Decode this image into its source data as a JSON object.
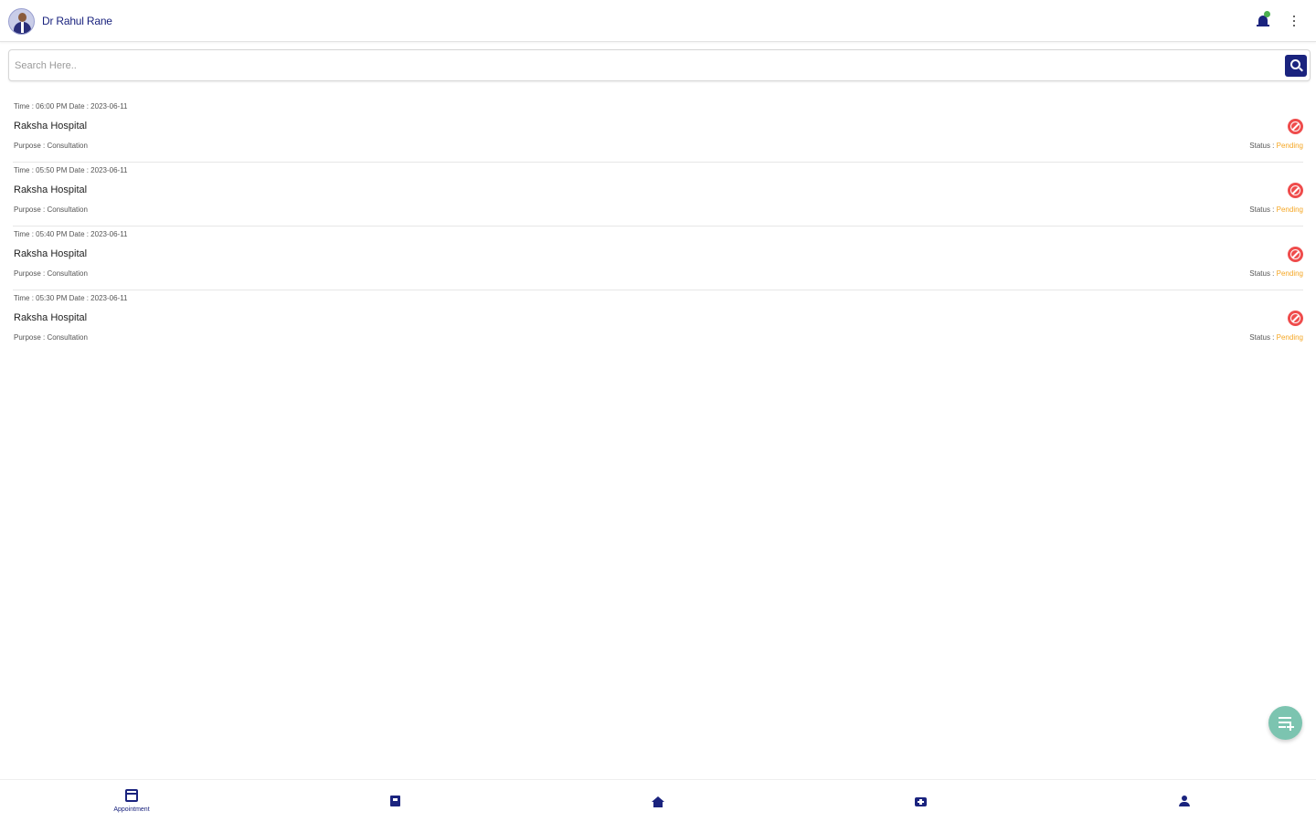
{
  "header": {
    "user_name": "Dr Rahul Rane"
  },
  "search": {
    "placeholder": "Search Here.."
  },
  "appointments": [
    {
      "meta": "Time : 06:00 PM  Date : 2023-06-11",
      "hospital": "Raksha Hospital",
      "purpose": "Purpose : Consultation",
      "status_label": "Status : ",
      "status_value": "Pending"
    },
    {
      "meta": "Time : 05:50 PM  Date : 2023-06-11",
      "hospital": "Raksha Hospital",
      "purpose": "Purpose : Consultation",
      "status_label": "Status : ",
      "status_value": "Pending"
    },
    {
      "meta": "Time : 05:40 PM  Date : 2023-06-11",
      "hospital": "Raksha Hospital",
      "purpose": "Purpose : Consultation",
      "status_label": "Status : ",
      "status_value": "Pending"
    },
    {
      "meta": "Time : 05:30 PM  Date : 2023-06-11",
      "hospital": "Raksha Hospital",
      "purpose": "Purpose : Consultation",
      "status_label": "Status : ",
      "status_value": "Pending"
    }
  ],
  "bottom_nav": {
    "appointment_label": "Appointment"
  },
  "icons": {
    "avatar": "doctor-avatar",
    "notification": "bell-icon",
    "menu": "more-vertical-icon",
    "search": "search-icon",
    "cancel": "cancel-icon",
    "fab": "add-list-icon",
    "nav": [
      "calendar-icon",
      "book-icon",
      "home-icon",
      "medical-kit-icon",
      "user-icon"
    ]
  },
  "colors": {
    "primary": "#1a237e",
    "pending": "#f5a623",
    "cancel": "#ef4c4c",
    "fab": "#7cc4b0",
    "notification_dot": "#4caf50"
  }
}
